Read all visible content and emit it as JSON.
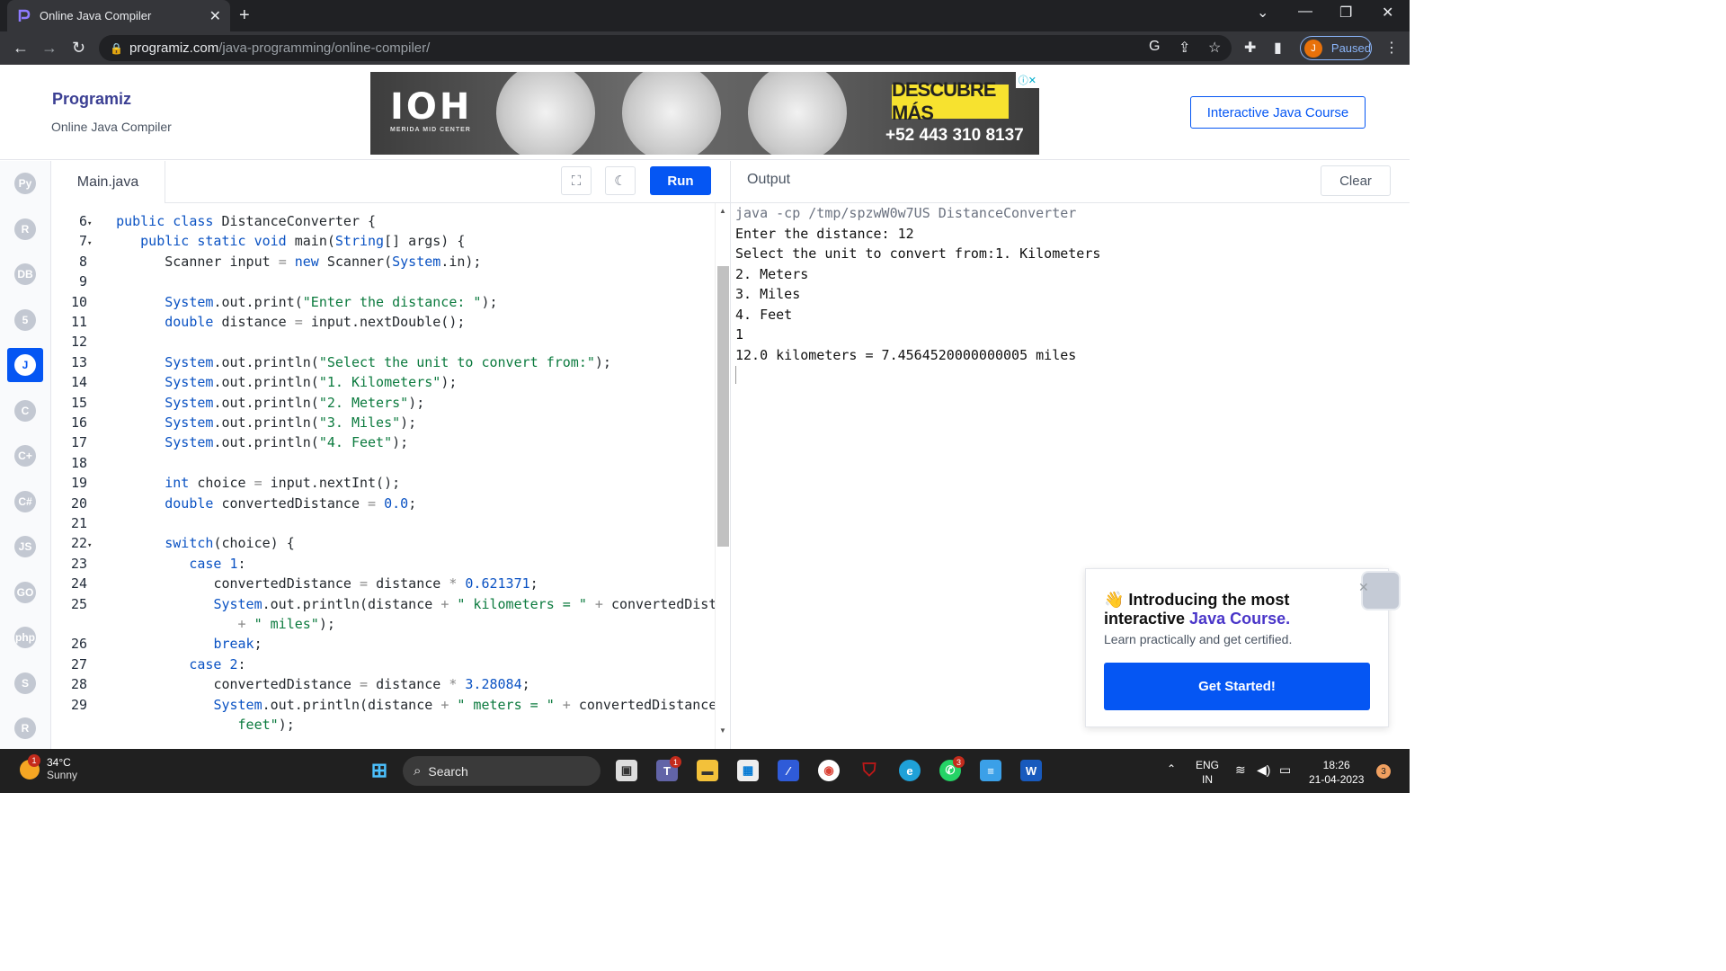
{
  "browser": {
    "tab_title": "Online Java Compiler",
    "url_host": "programiz.com",
    "url_path": "/java-programming/online-compiler/",
    "profile_initial": "J",
    "profile_status": "Paused"
  },
  "site": {
    "logo": "Programiz",
    "subtitle": "Online Java Compiler",
    "course_button": "Interactive Java Course",
    "ad": {
      "brand": "IOH",
      "brand_sub": "MERIDA MID CENTER",
      "cta": "DESCUBRE MÁS",
      "phone": "+52 443 310 8137"
    }
  },
  "rail": [
    {
      "name": "python",
      "label": "Py"
    },
    {
      "name": "r",
      "label": "R"
    },
    {
      "name": "sql",
      "label": "DB"
    },
    {
      "name": "html",
      "label": "5"
    },
    {
      "name": "java",
      "label": "J",
      "active": true
    },
    {
      "name": "c",
      "label": "C"
    },
    {
      "name": "cpp",
      "label": "C+"
    },
    {
      "name": "csharp",
      "label": "C#"
    },
    {
      "name": "js",
      "label": "JS"
    },
    {
      "name": "go",
      "label": "GO"
    },
    {
      "name": "php",
      "label": "php"
    },
    {
      "name": "swift",
      "label": "S"
    },
    {
      "name": "rust",
      "label": "R"
    }
  ],
  "editor": {
    "file_name": "Main.java",
    "run_label": "Run",
    "lines": [
      {
        "n": "6",
        "fold": true,
        "indent": 0,
        "tokens": [
          [
            "kw",
            "public class "
          ],
          [
            "",
            "DistanceConverter {"
          ]
        ]
      },
      {
        "n": "7",
        "fold": true,
        "indent": 1,
        "tokens": [
          [
            "kw",
            "public static void "
          ],
          [
            "",
            "main("
          ],
          [
            "kw",
            "String"
          ],
          [
            "",
            "[] args) {"
          ]
        ]
      },
      {
        "n": "8",
        "indent": 2,
        "tokens": [
          [
            "",
            "Scanner input "
          ],
          [
            "op",
            "= "
          ],
          [
            "kw",
            "new "
          ],
          [
            "",
            "Scanner("
          ],
          [
            "kw",
            "System"
          ],
          [
            "",
            ".in);"
          ]
        ]
      },
      {
        "n": "9",
        "indent": 0,
        "tokens": []
      },
      {
        "n": "10",
        "indent": 2,
        "tokens": [
          [
            "kw",
            "System"
          ],
          [
            "",
            ".out.print("
          ],
          [
            "str",
            "\"Enter the distance: \""
          ],
          [
            "",
            ");"
          ]
        ]
      },
      {
        "n": "11",
        "indent": 2,
        "tokens": [
          [
            "kw",
            "double "
          ],
          [
            "",
            "distance "
          ],
          [
            "op",
            "= "
          ],
          [
            "",
            "input.nextDouble();"
          ]
        ]
      },
      {
        "n": "12",
        "indent": 0,
        "tokens": []
      },
      {
        "n": "13",
        "indent": 2,
        "tokens": [
          [
            "kw",
            "System"
          ],
          [
            "",
            ".out.println("
          ],
          [
            "str",
            "\"Select the unit to convert from:\""
          ],
          [
            "",
            ");"
          ]
        ]
      },
      {
        "n": "14",
        "indent": 2,
        "tokens": [
          [
            "kw",
            "System"
          ],
          [
            "",
            ".out.println("
          ],
          [
            "str",
            "\"1. Kilometers\""
          ],
          [
            "",
            ");"
          ]
        ]
      },
      {
        "n": "15",
        "indent": 2,
        "tokens": [
          [
            "kw",
            "System"
          ],
          [
            "",
            ".out.println("
          ],
          [
            "str",
            "\"2. Meters\""
          ],
          [
            "",
            ");"
          ]
        ]
      },
      {
        "n": "16",
        "indent": 2,
        "tokens": [
          [
            "kw",
            "System"
          ],
          [
            "",
            ".out.println("
          ],
          [
            "str",
            "\"3. Miles\""
          ],
          [
            "",
            ");"
          ]
        ]
      },
      {
        "n": "17",
        "indent": 2,
        "tokens": [
          [
            "kw",
            "System"
          ],
          [
            "",
            ".out.println("
          ],
          [
            "str",
            "\"4. Feet\""
          ],
          [
            "",
            ");"
          ]
        ]
      },
      {
        "n": "18",
        "indent": 0,
        "tokens": []
      },
      {
        "n": "19",
        "indent": 2,
        "tokens": [
          [
            "kw",
            "int "
          ],
          [
            "",
            "choice "
          ],
          [
            "op",
            "= "
          ],
          [
            "",
            "input.nextInt();"
          ]
        ]
      },
      {
        "n": "20",
        "indent": 2,
        "tokens": [
          [
            "kw",
            "double "
          ],
          [
            "",
            "convertedDistance "
          ],
          [
            "op",
            "= "
          ],
          [
            "num",
            "0.0"
          ],
          [
            "",
            ";"
          ]
        ]
      },
      {
        "n": "21",
        "indent": 0,
        "tokens": []
      },
      {
        "n": "22",
        "fold": true,
        "indent": 2,
        "tokens": [
          [
            "kw",
            "switch"
          ],
          [
            "",
            "(choice) {"
          ]
        ]
      },
      {
        "n": "23",
        "indent": 3,
        "tokens": [
          [
            "kw",
            "case "
          ],
          [
            "num",
            "1"
          ],
          [
            "",
            ":"
          ]
        ]
      },
      {
        "n": "24",
        "indent": 4,
        "tokens": [
          [
            "",
            "convertedDistance "
          ],
          [
            "op",
            "= "
          ],
          [
            "",
            "distance "
          ],
          [
            "op",
            "* "
          ],
          [
            "num",
            "0.621371"
          ],
          [
            "",
            ";"
          ]
        ]
      },
      {
        "n": "25",
        "indent": 4,
        "tokens": [
          [
            "kw",
            "System"
          ],
          [
            "",
            ".out.println(distance "
          ],
          [
            "op",
            "+ "
          ],
          [
            "str",
            "\" kilometers = \" "
          ],
          [
            "op",
            "+ "
          ],
          [
            "",
            "convertedDistance"
          ]
        ]
      },
      {
        "n": "",
        "indent": 5,
        "tokens": [
          [
            "op",
            "+ "
          ],
          [
            "str",
            "\" miles\""
          ],
          [
            "",
            ");"
          ]
        ]
      },
      {
        "n": "26",
        "indent": 4,
        "tokens": [
          [
            "kw",
            "break"
          ],
          [
            "",
            ";"
          ]
        ]
      },
      {
        "n": "27",
        "indent": 3,
        "tokens": [
          [
            "kw",
            "case "
          ],
          [
            "num",
            "2"
          ],
          [
            "",
            ":"
          ]
        ]
      },
      {
        "n": "28",
        "indent": 4,
        "tokens": [
          [
            "",
            "convertedDistance "
          ],
          [
            "op",
            "= "
          ],
          [
            "",
            "distance "
          ],
          [
            "op",
            "* "
          ],
          [
            "num",
            "3.28084"
          ],
          [
            "",
            ";"
          ]
        ]
      },
      {
        "n": "29",
        "indent": 4,
        "tokens": [
          [
            "kw",
            "System"
          ],
          [
            "",
            ".out.println(distance "
          ],
          [
            "op",
            "+ "
          ],
          [
            "str",
            "\" meters = \" "
          ],
          [
            "op",
            "+ "
          ],
          [
            "",
            "convertedDistance "
          ],
          [
            "op",
            "+ "
          ],
          [
            "str",
            "\""
          ]
        ]
      },
      {
        "n": "",
        "indent": 5,
        "tokens": [
          [
            "str",
            "feet\""
          ],
          [
            "",
            ");"
          ]
        ]
      }
    ]
  },
  "output": {
    "title": "Output",
    "clear_label": "Clear",
    "lines": [
      {
        "cmd": true,
        "text": "java -cp /tmp/spzwW0w7US DistanceConverter"
      },
      {
        "text": "Enter the distance: 12"
      },
      {
        "text": "Select the unit to convert from:1. Kilometers"
      },
      {
        "text": "2. Meters"
      },
      {
        "text": "3. Miles"
      },
      {
        "text": "4. Feet"
      },
      {
        "text": "1"
      },
      {
        "text": "12.0 kilometers = 7.4564520000000005 miles"
      }
    ]
  },
  "promo": {
    "line1": "Introducing the most",
    "line2_pre": "interactive ",
    "line2_accent": "Java Course.",
    "sub": "Learn practically and get certified.",
    "button": "Get Started!"
  },
  "taskbar": {
    "temp": "34°C",
    "weather": "Sunny",
    "weather_badge": "1",
    "search": "Search",
    "lang1": "ENG",
    "lang2": "IN",
    "time": "18:26",
    "date": "21-04-2023",
    "notifications": "3",
    "teams_badge": "1",
    "whatsapp_badge": "3"
  }
}
